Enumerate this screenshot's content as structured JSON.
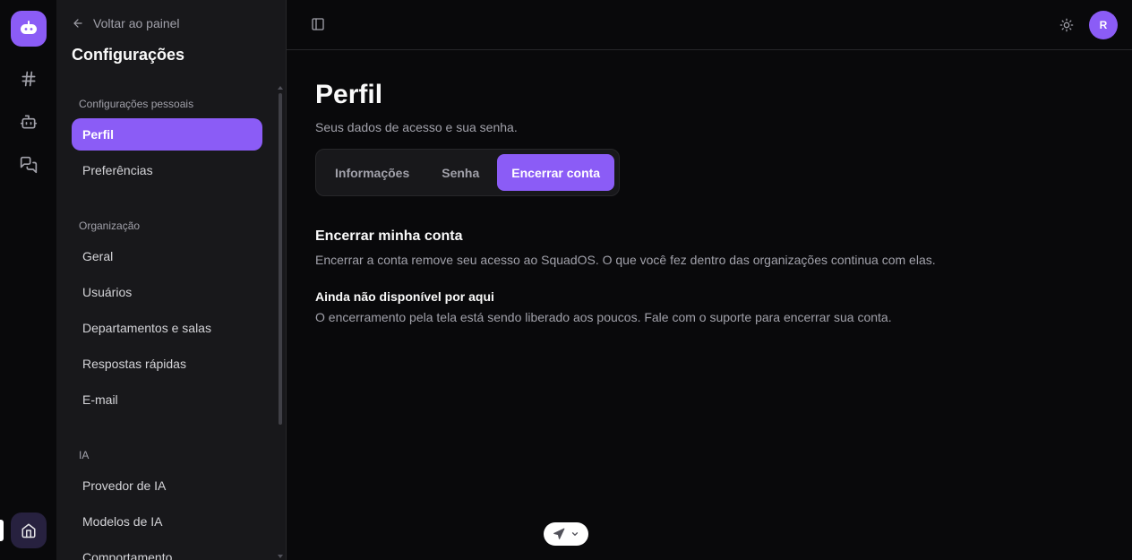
{
  "app": {
    "brand_color": "#8b5cf6"
  },
  "rail": {
    "items": [
      {
        "icon": "hash-icon"
      },
      {
        "icon": "bot-icon"
      },
      {
        "icon": "chat-icon"
      }
    ],
    "home_icon": "home-icon"
  },
  "sidebar": {
    "back_label": "Voltar ao painel",
    "title": "Configurações",
    "groups": [
      {
        "label": "Configurações pessoais",
        "items": [
          "Perfil",
          "Preferências"
        ]
      },
      {
        "label": "Organização",
        "items": [
          "Geral",
          "Usuários",
          "Departamentos e salas",
          "Respostas rápidas",
          "E-mail"
        ]
      },
      {
        "label": "IA",
        "items": [
          "Provedor de IA",
          "Modelos de IA",
          "Comportamento"
        ]
      }
    ],
    "active_item": "Perfil"
  },
  "header": {
    "avatar_initial": "R"
  },
  "main": {
    "title": "Perfil",
    "subtitle": "Seus dados de acesso e sua senha.",
    "tabs": [
      {
        "label": "Informações"
      },
      {
        "label": "Senha"
      },
      {
        "label": "Encerrar conta"
      }
    ],
    "active_tab": "Encerrar conta",
    "section_title": "Encerrar minha conta",
    "section_desc": "Encerrar a conta remove seu acesso ao SquadOS. O que você fez dentro das organizações continua com elas.",
    "notice_title": "Ainda não disponível por aqui",
    "notice_desc": "O encerramento pela tela está sendo liberado aos poucos. Fale com o suporte para encerrar sua conta."
  }
}
